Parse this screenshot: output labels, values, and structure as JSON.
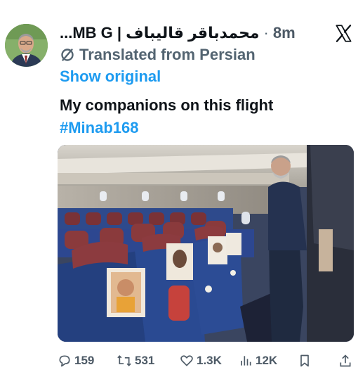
{
  "header": {
    "author_name": "محمدباقر قالیباف | MB G...",
    "separator": "·",
    "time": "8m"
  },
  "translation": {
    "label": "Translated from Persian",
    "show_original": "Show original"
  },
  "post": {
    "text": "My companions on this flight",
    "hashtag": "#Minab168"
  },
  "actions": {
    "replies": "159",
    "reposts": "531",
    "likes": "1.3K",
    "views": "12K"
  },
  "colors": {
    "link": "#1d9bf0",
    "muted": "#536471",
    "text": "#0f1419"
  },
  "icons": [
    "x-logo-icon",
    "translate-icon",
    "reply-icon",
    "repost-icon",
    "like-icon",
    "views-icon",
    "bookmark-icon",
    "share-icon"
  ]
}
